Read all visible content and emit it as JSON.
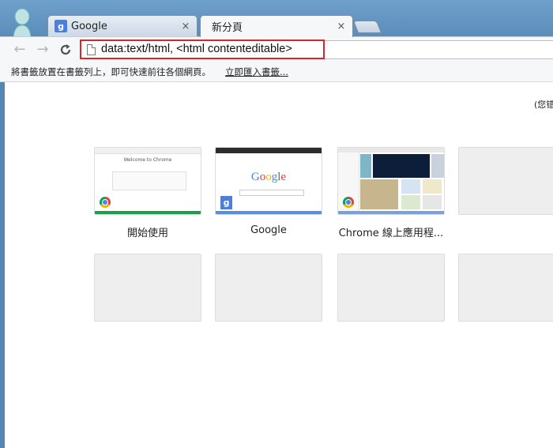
{
  "tabs": [
    {
      "title": "Google",
      "favicon": "g",
      "active": false
    },
    {
      "title": "新分頁",
      "active": true
    }
  ],
  "tab_close_glyph": "×",
  "toolbar": {
    "back_glyph": "←",
    "forward_glyph": "→",
    "reload_glyph": "C",
    "url": "data:text/html, <html contenteditable>"
  },
  "bookmarks_bar": {
    "message": "將書籤放置在書籤列上，即可快速前往各個網頁。",
    "import_link": "立即匯入書籤..."
  },
  "content": {
    "topright_text": "(您错",
    "tiles": [
      {
        "label": "開始使用",
        "thumb": "welcome",
        "thumb_title": "Welcome to Chrome",
        "bar_color": "#1e9e4a"
      },
      {
        "label": "Google",
        "thumb": "google",
        "thumb_title": "Google",
        "bar_color": "#5a8fe0"
      },
      {
        "label": "Chrome 線上應用程...",
        "thumb": "webstore",
        "bar_color": "#7aa2d8"
      },
      {
        "label": "",
        "thumb": "empty"
      },
      {
        "label": "",
        "thumb": "empty"
      },
      {
        "label": "",
        "thumb": "empty"
      },
      {
        "label": "",
        "thumb": "empty"
      },
      {
        "label": "",
        "thumb": "empty"
      }
    ]
  },
  "colors": {
    "highlight_border": "#d8262d",
    "frame_blue": "#5d8cb8",
    "google_blue": "#4a7fe0"
  }
}
